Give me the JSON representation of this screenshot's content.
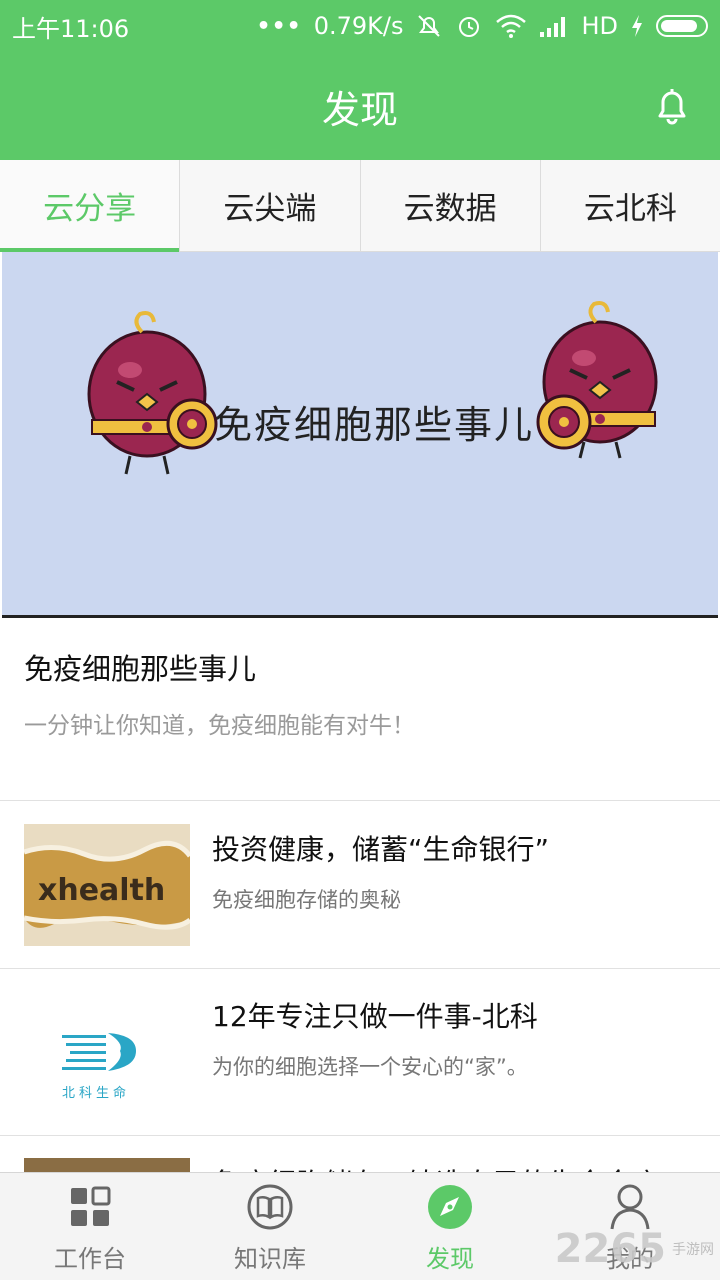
{
  "statusbar": {
    "time": "上午11:06",
    "network_speed": "0.79K/s",
    "network_type": "HD",
    "icons": [
      "more-dots-icon",
      "mute-icon",
      "alarm-icon",
      "wifi-icon",
      "signal-icon",
      "charging-icon",
      "battery-icon"
    ]
  },
  "header": {
    "title": "发现",
    "bell_icon": "bell-icon"
  },
  "tabs": [
    {
      "label": "云分享",
      "active": true
    },
    {
      "label": "云尖端",
      "active": false
    },
    {
      "label": "云数据",
      "active": false
    },
    {
      "label": "云北科",
      "active": false
    }
  ],
  "banner": {
    "caption": "免疫细胞那些事儿"
  },
  "featured": {
    "title": "免疫细胞那些事儿",
    "description": "一分钟让你知道，免疫细胞能有对牛！"
  },
  "articles": [
    {
      "title": "投资健康，储蓄“生命银行”",
      "description": "免疫细胞存储的奥秘",
      "thumb_text": "xhealth"
    },
    {
      "title": "12年专注只做一件事-北科",
      "description": "为你的细胞选择一个安心的“家”。",
      "thumb_text": "北科生命"
    },
    {
      "title": "免疫细胞储存，铸造自己的生命金库",
      "description": ""
    }
  ],
  "bottomnav": [
    {
      "label": "工作台",
      "icon": "grid-icon",
      "active": false
    },
    {
      "label": "知识库",
      "icon": "book-icon",
      "active": false
    },
    {
      "label": "发现",
      "icon": "compass-icon",
      "active": true
    },
    {
      "label": "我的",
      "icon": "person-icon",
      "active": false
    }
  ],
  "watermark": {
    "logo_text": "2265",
    "site": "手游网"
  },
  "colors": {
    "brand_green": "#5cc968",
    "banner_bg": "#cbd7f0"
  }
}
